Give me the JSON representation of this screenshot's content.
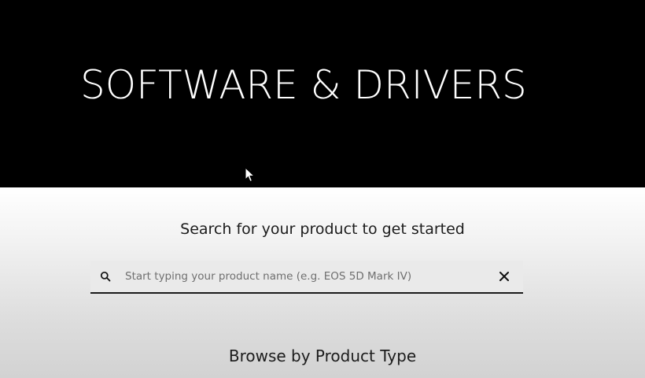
{
  "hero": {
    "title": "SOFTWARE & DRIVERS",
    "background_color": "#000000",
    "text_color": "#ffffff"
  },
  "search": {
    "heading": "Search for your product to get started",
    "placeholder": "Start typing your product name (e.g. EOS 5D Mark IV)",
    "value": "",
    "search_icon": "search-icon",
    "clear_icon": "close-icon"
  },
  "browse": {
    "heading": "Browse by Product Type"
  },
  "pointer": {
    "icon": "mouse-pointer-icon"
  }
}
